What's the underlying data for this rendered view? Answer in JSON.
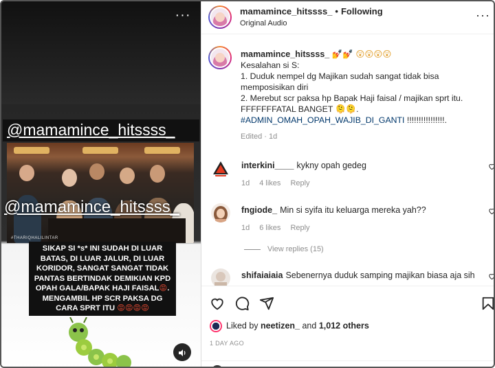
{
  "video": {
    "overlay_handle_top": "@mamamince_hitssss_",
    "overlay_handle_mid": "@mamamince_hitssss_",
    "watermark": "#THARIQHALILINTAR",
    "caption_text": "SIKAP SI *s* INI SUDAH DI LUAR BATAS, DI LUAR JALUR, DI LUAR KORIDOR, SANGAT SANGAT TIDAK PANTAS BERTINDAK DEMIKIAN KPD OPAH GALA/BAPAK HAJI FAISAL",
    "caption_line2": "MENGAMBIL HP SCR PAKSA DG CARA SPRT ITU",
    "caption_emoji": "😡",
    "caption_emojis_end": "😡😡😡😡",
    "more_icon": "ellipsis-icon",
    "sound_icon": "speaker-icon"
  },
  "header": {
    "username": "mamamince_hitssss_",
    "separator": "•",
    "follow_status": "Following",
    "audio": "Original Audio",
    "menu_icon": "ellipsis-icon"
  },
  "caption": {
    "username": "mamamince_hitssss_",
    "user_emojis": " 💅💅 😲😲😲😲",
    "text_body": "Kesalahan si S:\n1. Duduk nempel dg Majikan sudah sangat tidak bisa memposisikan diri\n2. Merebut scr paksa hp Bapak Haji faisal / majikan sprt itu. FFFFFFFATAL BANGET 🫠🫠.\n",
    "hashtag": "#ADMIN_OMAH_OPAH_WAJIB_DI_GANTI",
    "text_end": " !!!!!!!!!!!!!!!!.",
    "meta": "Edited · 1d"
  },
  "comments": [
    {
      "username": "interkini____",
      "text": "kykny opah gedeg",
      "time": "1d",
      "likes": "4 likes",
      "reply": "Reply"
    },
    {
      "username": "fngiode_",
      "text": "Min si syifa itu keluarga mereka yah??",
      "time": "1d",
      "likes": "6 likes",
      "reply": "Reply"
    },
    {
      "username": "shifaiaiaia",
      "text": "Sebenernya duduk samping majikan biasa aja sih ya,",
      "time": "",
      "likes": "",
      "reply": ""
    }
  ],
  "view_replies": "View replies (15)",
  "actions": {
    "like_icon": "heart-icon",
    "comment_icon": "comment-icon",
    "share_icon": "send-icon",
    "save_icon": "bookmark-icon"
  },
  "likes": {
    "prefix": "Liked by ",
    "user": "neetizen_",
    "middle": " and ",
    "count": "1,012 others"
  },
  "posted": "1 DAY AGO",
  "colors": {
    "hashtag": "#00376b",
    "meta_gray": "#8e8e8e",
    "text": "#262626"
  }
}
